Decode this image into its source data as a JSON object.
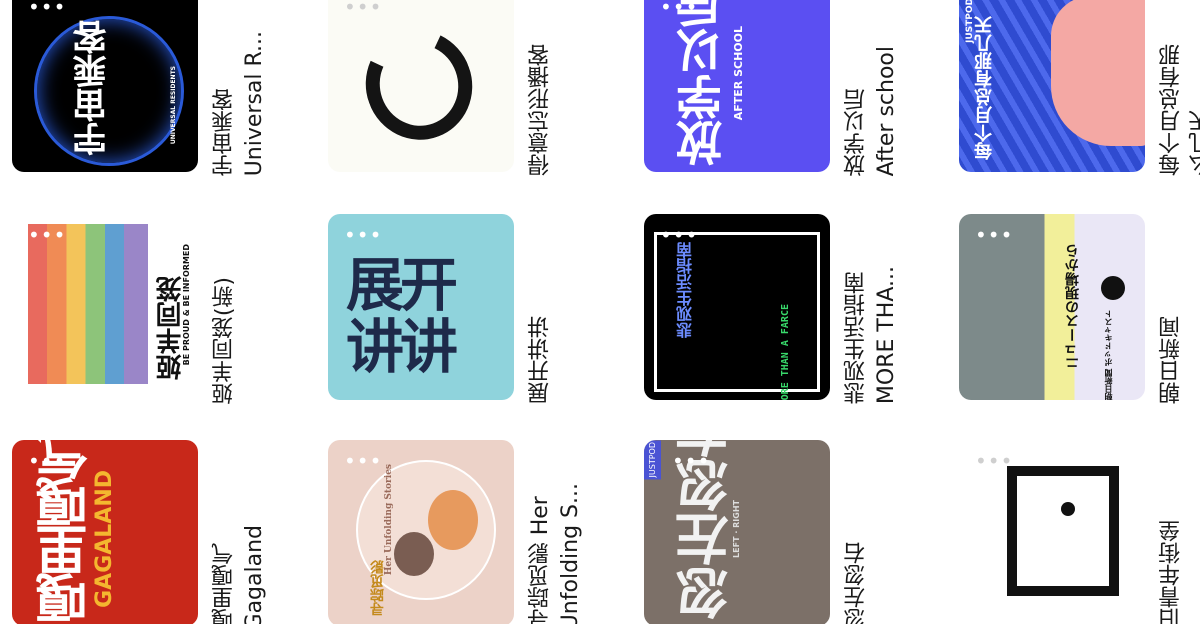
{
  "podcasts": [
    {
      "title_line1": "宇宙乘客",
      "title_line2": "Universal R...",
      "cover_text": "宇宙乘客",
      "cover_sub": "UNIVERSAL RESIDENTS"
    },
    {
      "title_line1": "得意忘形播客",
      "title_line2": ""
    },
    {
      "title_line1": "放学以后",
      "title_line2": "After school",
      "cover_text": "放学以后",
      "cover_sub": "AFTER SCHOOL"
    },
    {
      "title_line1": "每个月总有那",
      "title_line2": "么几天",
      "cover_text": "每个月总有那几天",
      "cover_sub": "JUSTPOD"
    },
    {
      "title_line1": "姬羊同笼(新)",
      "title_line2": "",
      "cover_text": "姬羊同笼",
      "cover_sub": "BE PROUD & BE INFORMED"
    },
    {
      "title_line1": "展开讲讲",
      "title_line2": "",
      "cover_text": "展开讲讲"
    },
    {
      "title_line1": "悲观生活指南",
      "title_line2": "MORE THA...",
      "cover_text": "悲观生活指南",
      "cover_sub": "MORE THAN A FARCE"
    },
    {
      "title_line1": "朝日新闻",
      "title_line2": "",
      "cover_text": "ニュースの現場から",
      "cover_sub": "朝日新聞 ポッドキャスト"
    },
    {
      "title_line1": "嘎里嘎气",
      "title_line2": "Gagaland",
      "cover_text": "嘎里嘎气",
      "cover_sub": "GAGALAND"
    },
    {
      "title_line1": "寻踪觅影 Her",
      "title_line2": "Unfolding S...",
      "cover_text": "寻踪觅影",
      "cover_sub": "Her Unfolding Stories"
    },
    {
      "title_line1": "忽左忽右",
      "title_line2": "",
      "cover_text": "忽左忽右",
      "cover_sub": "LEFT · RIGHT",
      "badge": "JUSTPOD"
    },
    {
      "title_line1": "旧青年街垒",
      "title_line2": "",
      "cover_text": "旧"
    }
  ],
  "more_label": "•••",
  "colors": {
    "universal": "#000000",
    "after_school": "#5b4ff2",
    "monthly": "#2f4bd0",
    "zhankai": "#8fd3dc",
    "asahi": "#e9e6f5",
    "gaga": "#c8281a",
    "xunzong": "#ecd2c8",
    "huzuo": "#7c7068"
  }
}
